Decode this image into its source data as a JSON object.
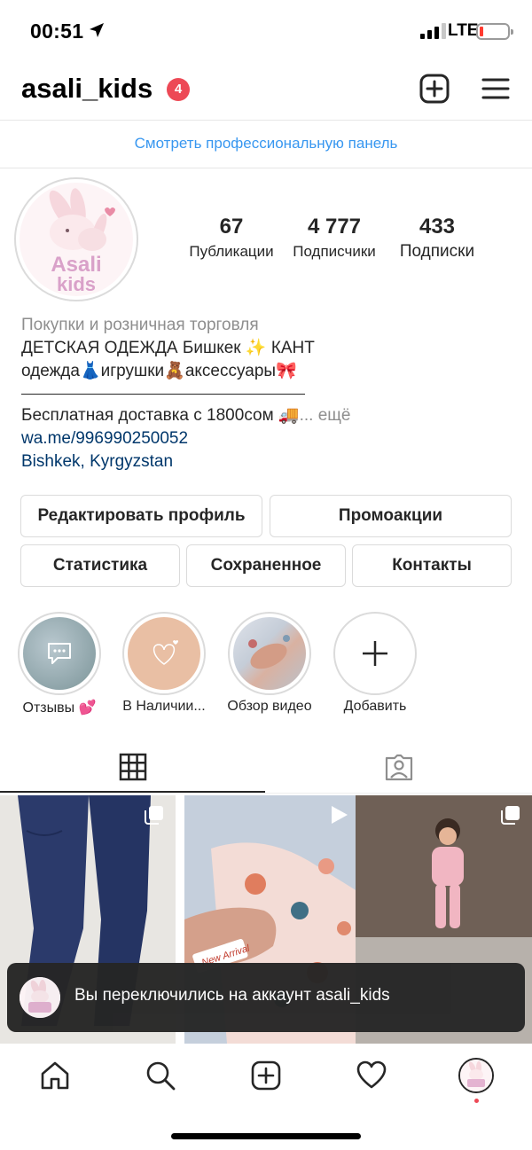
{
  "status_bar": {
    "time": "00:51",
    "network": "LTE",
    "battery_color": "#ff3b30"
  },
  "header": {
    "username": "asali_kids",
    "notification_count": "4",
    "new_post_icon": "plus-square-icon",
    "menu_icon": "hamburger-menu-icon"
  },
  "professional_panel": {
    "label": "Смотреть профессиональную панель",
    "color": "#3897f0"
  },
  "profile": {
    "avatar_text_1": "Asali",
    "avatar_text_2": "kids",
    "stats": [
      {
        "value": "67",
        "label": "Публикации"
      },
      {
        "value": "4 777",
        "label": "Подписчики"
      },
      {
        "value": "433",
        "label": "Подписки"
      }
    ],
    "bio": {
      "category": "Покупки и розничная торговля",
      "line1": "ДЕТСКАЯ ОДЕЖДА Бишкек ✨ КАНТ",
      "line2": "одежда👗игрушки🧸аксессуары🎀",
      "line3": "Бесплатная доставка с 1800сом 🚚",
      "more": "... ещё",
      "link": "wa.me/996990250052",
      "location": "Bishkek, Kyrgyzstan"
    }
  },
  "buttons": {
    "edit_profile": "Редактировать профиль",
    "promotions": "Промоакции",
    "insights": "Статистика",
    "saved": "Сохраненное",
    "contacts": "Контакты"
  },
  "highlights": [
    {
      "label": "Отзывы 💕",
      "icon": "chat-bubble-icon"
    },
    {
      "label": "В Наличии...",
      "icon": "heart-sketch-icon"
    },
    {
      "label": "Обзор видео",
      "icon": "video-thumbnail"
    },
    {
      "label": "Добавить",
      "icon": "plus-icon"
    }
  ],
  "tabs": {
    "grid_icon": "grid-icon",
    "tagged_icon": "tagged-person-icon"
  },
  "grid": {
    "post1_badge": "multiple-photos-icon",
    "post2_badge": "video-play-icon",
    "post2_caption": "New Arrival",
    "post3_badge": "multiple-photos-icon"
  },
  "toast": {
    "message": "Вы переключились на аккаунт asali_kids"
  },
  "bottom_nav": {
    "items": [
      "home-icon",
      "search-icon",
      "new-post-icon",
      "activity-heart-icon",
      "profile-avatar"
    ],
    "dot_color": "#ed4956"
  }
}
